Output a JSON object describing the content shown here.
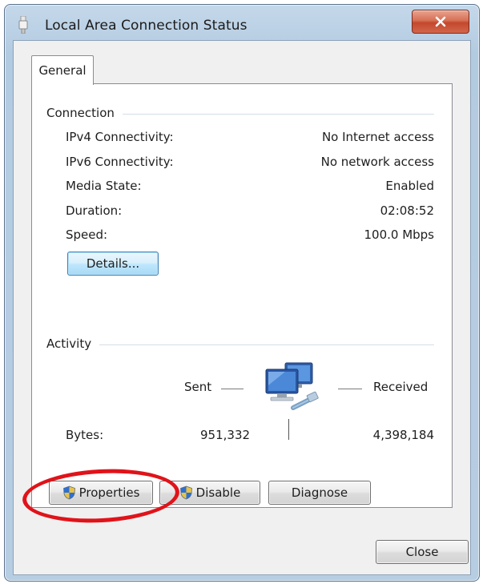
{
  "window": {
    "title": "Local Area Connection Status",
    "close_glyph": "✕"
  },
  "tabs": [
    {
      "label": "General",
      "selected": true
    }
  ],
  "connection": {
    "group_label": "Connection",
    "rows": [
      {
        "label": "IPv4 Connectivity:",
        "value": "No Internet access"
      },
      {
        "label": "IPv6 Connectivity:",
        "value": "No network access"
      },
      {
        "label": "Media State:",
        "value": "Enabled"
      },
      {
        "label": "Duration:",
        "value": "02:08:52"
      },
      {
        "label": "Speed:",
        "value": "100.0 Mbps"
      }
    ],
    "details_button": "Details..."
  },
  "activity": {
    "group_label": "Activity",
    "sent_label": "Sent",
    "received_label": "Received",
    "bytes_label": "Bytes:",
    "bytes_sent": "951,332",
    "bytes_received": "4,398,184",
    "icon": "network-computers-icon"
  },
  "buttons": {
    "properties": "Properties",
    "disable": "Disable",
    "diagnose": "Diagnose",
    "close": "Close"
  },
  "colors": {
    "highlight_ellipse": "#e0131a",
    "close_button_red": "#c4482c"
  }
}
